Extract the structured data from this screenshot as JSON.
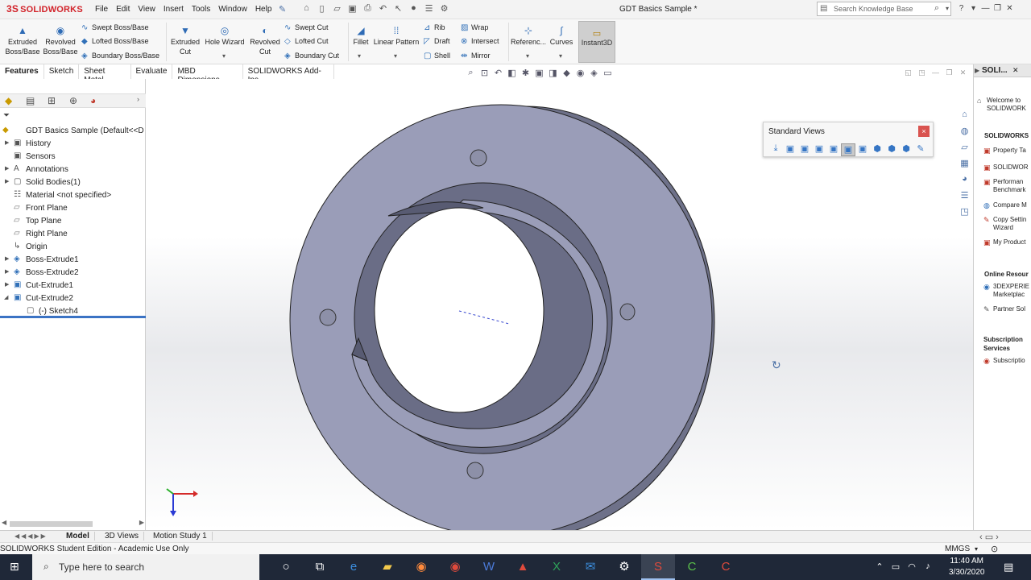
{
  "app": {
    "logo_mark": "3S",
    "logo": "SOLIDWORKS",
    "title": "GDT Basics Sample *"
  },
  "menu": [
    "File",
    "Edit",
    "View",
    "Insert",
    "Tools",
    "Window",
    "Help"
  ],
  "search": {
    "placeholder": "Search Knowledge Base"
  },
  "ribbon": {
    "extruded_boss": "Extruded Boss/Base",
    "revolved_boss": "Revolved Boss/Base",
    "swept_boss": "Swept Boss/Base",
    "lofted_boss": "Lofted Boss/Base",
    "boundary_boss": "Boundary Boss/Base",
    "extruded_cut": "Extruded Cut",
    "hole_wizard": "Hole Wizard",
    "revolved_cut": "Revolved Cut",
    "swept_cut": "Swept Cut",
    "lofted_cut": "Lofted Cut",
    "boundary_cut": "Boundary Cut",
    "fillet": "Fillet",
    "linear_pattern": "Linear Pattern",
    "rib": "Rib",
    "draft": "Draft",
    "shell": "Shell",
    "wrap": "Wrap",
    "intersect": "Intersect",
    "mirror": "Mirror",
    "reference": "Referenc...",
    "curves": "Curves",
    "instant3d": "Instant3D"
  },
  "command_tabs": [
    "Features",
    "Sketch",
    "Sheet Metal",
    "Evaluate",
    "MBD Dimensions",
    "SOLIDWORKS Add-Ins"
  ],
  "tree": {
    "root": "GDT Basics Sample  (Default<<D",
    "items": [
      "History",
      "Sensors",
      "Annotations",
      "Solid Bodies(1)",
      "Material <not specified>",
      "Front Plane",
      "Top Plane",
      "Right Plane",
      "Origin",
      "Boss-Extrude1",
      "Boss-Extrude2",
      "Cut-Extrude1",
      "Cut-Extrude2",
      "(-) Sketch4"
    ]
  },
  "standard_views": {
    "title": "Standard Views",
    "close": "×"
  },
  "task_pane": {
    "header": "SOLI...",
    "welcome": [
      "Welcome to",
      "SOLIDWORK"
    ],
    "section1": "SOLIDWORKS",
    "items1": [
      "Property Ta",
      "SOLIDWOR",
      "Performan",
      "Benchmark",
      "Compare M",
      "Copy Settin",
      "Wizard",
      "My Product"
    ],
    "section2": "Online Resour",
    "items2": [
      "3DEXPERIE",
      "Marketplac",
      "Partner Sol"
    ],
    "section3": [
      "Subscription",
      "Services"
    ],
    "items3": [
      "Subscriptio"
    ]
  },
  "bottom_tabs": [
    "Model",
    "3D Views",
    "Motion Study 1"
  ],
  "status": {
    "text": "SOLIDWORKS Student Edition - Academic Use Only",
    "units": "MMGS"
  },
  "taskbar": {
    "search": "Type here to search",
    "time": "11:40 AM",
    "date": "3/30/2020"
  },
  "colors": {
    "part_face": "#9a9db8",
    "part_side": "#6e7189",
    "brand_red": "#d2232a",
    "selection_blue": "#3b73c4"
  }
}
